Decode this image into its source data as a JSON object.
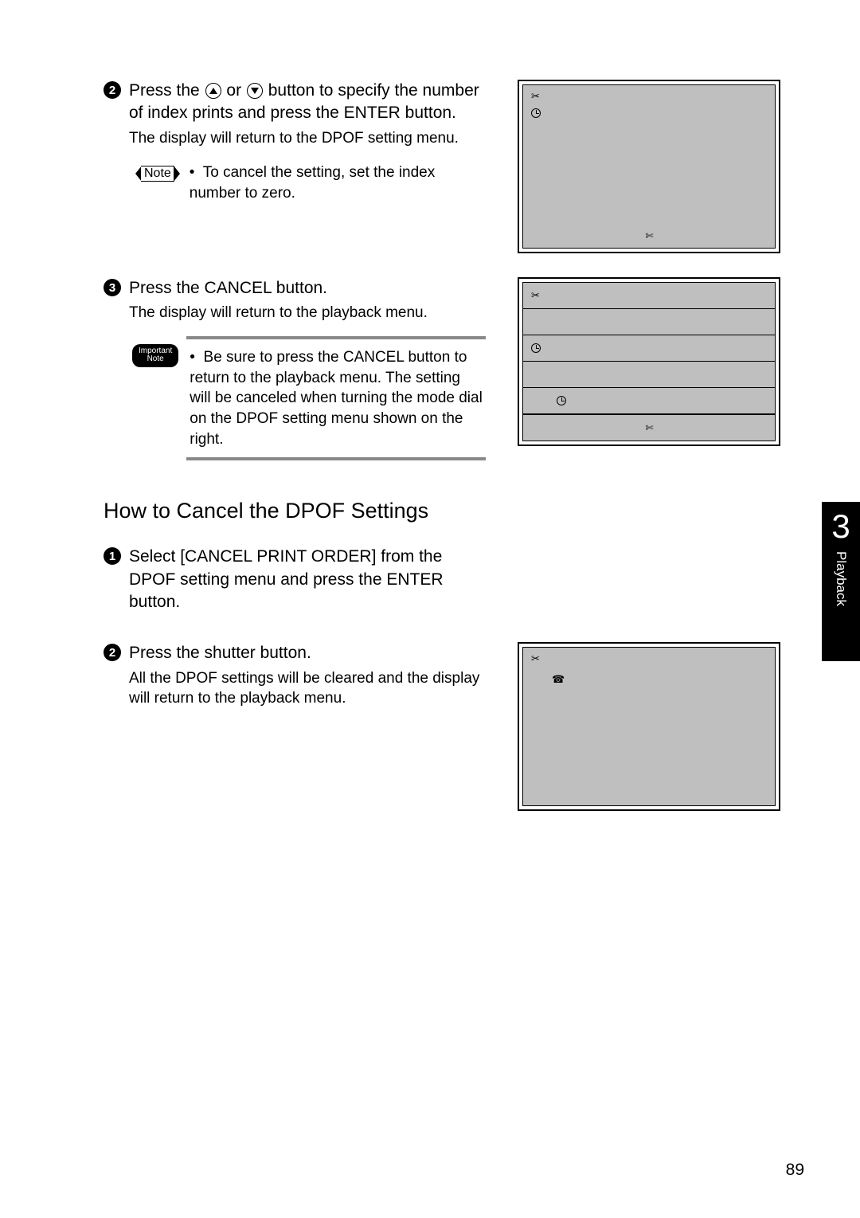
{
  "steps": {
    "s2": {
      "num": "2",
      "main_a": "Press the ",
      "main_b": " or ",
      "main_c": " button to specify the number of index prints and press the ENTER button.",
      "sub": "The display will return to the DPOF setting menu."
    },
    "note1": {
      "label": "Note",
      "text": "To cancel the setting, set the index number to zero."
    },
    "s3": {
      "num": "3",
      "main": "Press the CANCEL button.",
      "sub": "The display will return to the playback menu."
    },
    "important": {
      "label_a": "Important",
      "label_b": "Note",
      "text": "Be sure to press the CANCEL button to return to the playback menu. The setting will be canceled when turning the mode dial on the DPOF setting menu shown on the right."
    }
  },
  "heading": "How to Cancel the DPOF Settings",
  "cancel": {
    "s1": {
      "num": "1",
      "main": "Select [CANCEL PRINT ORDER] from the DPOF setting menu and press the ENTER button."
    },
    "s2": {
      "num": "2",
      "main": "Press the shutter button.",
      "sub": "All the DPOF settings will be cleared and the display will return to the playback menu."
    }
  },
  "sidetab": {
    "num": "3",
    "label": "Playback"
  },
  "page_number": "89"
}
